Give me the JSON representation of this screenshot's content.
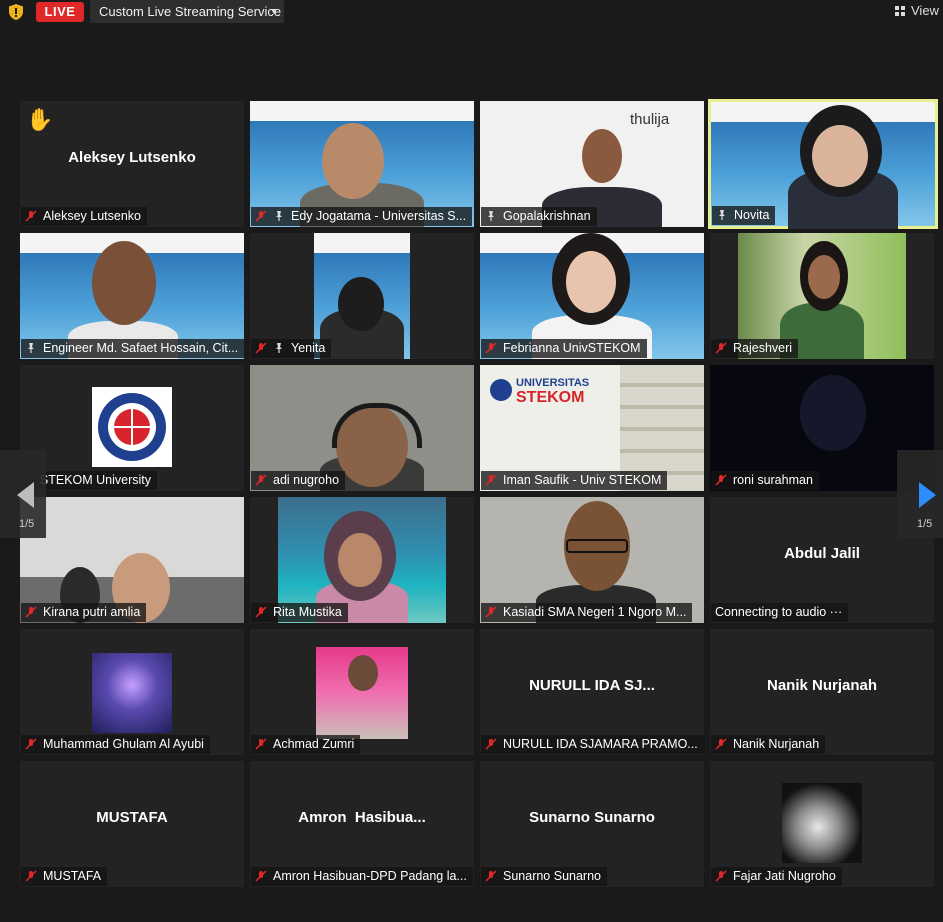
{
  "topbar": {
    "live_label": "LIVE",
    "stream_service": "Custom Live Streaming Service",
    "view_label": "View"
  },
  "pagination": {
    "left": "1/5",
    "right": "1/5"
  },
  "colors": {
    "live": "#e02828",
    "active_speaker": "#e7ef8f",
    "next_arrow": "#2d8cff",
    "muted_mic": "#e02828"
  },
  "tiles": [
    {
      "center": "Aleksey Lutsenko",
      "label": "Aleksey Lutsenko",
      "muted": true,
      "hand_raised": true
    },
    {
      "label": "Edy Jogatama - Universitas S...",
      "muted": true,
      "pinned": true
    },
    {
      "label": "Gopalakrishnan",
      "muted": false,
      "pinned": true
    },
    {
      "label": "Novita",
      "muted": false,
      "pinned": true,
      "active": true
    },
    {
      "label": "Engineer Md. Safaet Hossain, Cit...",
      "muted": false,
      "pinned": true
    },
    {
      "label": "Yenita",
      "muted": true,
      "pinned": true
    },
    {
      "label": "Febrianna UnivSTEKOM",
      "muted": true
    },
    {
      "label": "Rajeshveri",
      "muted": true
    },
    {
      "label": "STEKOM University",
      "muted": false
    },
    {
      "label": "adi nugroho",
      "muted": true
    },
    {
      "label": "Iman Saufik - Univ STEKOM",
      "muted": true
    },
    {
      "label": "roni surahman",
      "muted": true
    },
    {
      "label": "Kirana putri amlia",
      "muted": true
    },
    {
      "label": "Rita Mustika",
      "muted": true
    },
    {
      "label": "Kasiadi SMA Negeri 1 Ngoro M...",
      "muted": true
    },
    {
      "center": "Abdul Jalil",
      "label": "Connecting to audio ···",
      "muted": false
    },
    {
      "label": "Muhammad Ghulam Al Ayubi",
      "muted": true
    },
    {
      "label": "Achmad Zumri",
      "muted": true
    },
    {
      "center": "NURULL IDA SJ...",
      "label": "NURULL IDA SJAMARA PRAMO...",
      "muted": true
    },
    {
      "center": "Nanik Nurjanah",
      "label": "Nanik Nurjanah",
      "muted": true
    },
    {
      "center": "MUSTAFA",
      "label": "MUSTAFA",
      "muted": true
    },
    {
      "center": "Amron  Hasibua...",
      "label": "Amron Hasibuan-DPD Padang la...",
      "muted": true
    },
    {
      "center": "Sunarno Sunarno",
      "label": "Sunarno Sunarno",
      "muted": true
    },
    {
      "label": "Fajar Jati Nugroho",
      "muted": true
    }
  ]
}
